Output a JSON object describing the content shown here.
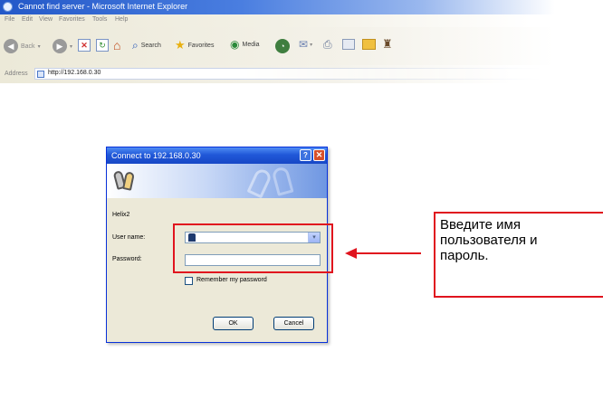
{
  "browser": {
    "title": "Cannot find server - Microsoft Internet Explorer",
    "menu": [
      "File",
      "Edit",
      "View",
      "Favorites",
      "Tools",
      "Help"
    ],
    "toolbar": {
      "back_label": "Back",
      "search_label": "Search",
      "favorites_label": "Favorites",
      "media_label": "Media"
    },
    "address": {
      "label": "Address",
      "url": "http://192.168.0.30"
    }
  },
  "dialog": {
    "title": "Connect to 192.168.0.30",
    "help_glyph": "?",
    "close_glyph": "✕",
    "realm": "Helix2",
    "username_label": "User name:",
    "password_label": "Password:",
    "remember_label": "Remember my password",
    "ok_label": "OK",
    "cancel_label": "Cancel",
    "dropdown_glyph": "▾"
  },
  "annotation": {
    "text_line1": "Введите имя",
    "text_line2": "пользователя и",
    "text_line3": "пароль.",
    "color": "#e0141e"
  },
  "icons": {
    "back": "back-arrow-icon",
    "forward": "forward-arrow-icon",
    "stop": "stop-icon",
    "refresh": "refresh-icon",
    "home": "home-icon",
    "search": "search-icon",
    "favorites": "favorites-star-icon",
    "media": "media-icon",
    "history": "history-icon",
    "mail": "mail-icon",
    "print": "print-icon",
    "edit": "edit-icon",
    "folder": "folder-icon",
    "messenger": "messenger-icon"
  }
}
